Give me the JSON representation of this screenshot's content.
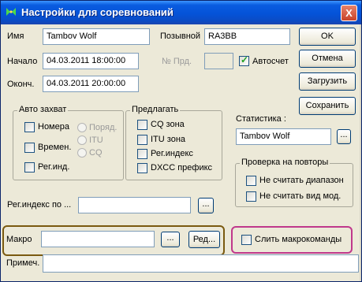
{
  "window": {
    "title": "Настройки для соревнований",
    "close_label": "X"
  },
  "fields": {
    "name": {
      "label": "Имя",
      "value": "Tambov Wolf"
    },
    "callsign": {
      "label": "Позывной",
      "value": "RA3BB"
    },
    "start": {
      "label": "Начало",
      "value": "04.03.2011 18:00:00"
    },
    "end": {
      "label": "Оконч.",
      "value": "04.03.2011 20:00:00"
    },
    "prd_no": {
      "label": "№ Прд.",
      "value": ""
    },
    "autocount": {
      "label": "Автосчет",
      "checked": true
    }
  },
  "buttons": {
    "ok": "OK",
    "cancel": "Отмена",
    "load": "Загрузить",
    "save": "Сохранить",
    "stats_browse": "...",
    "reg_browse": "...",
    "macro_browse": "...",
    "macro_edit": "Ред..."
  },
  "auto_capture": {
    "title": "Авто захват",
    "items": [
      {
        "label": "Номера",
        "checked": false
      },
      {
        "label": "Времен.",
        "checked": false
      },
      {
        "label": "Рег.инд.",
        "checked": false
      }
    ],
    "radios": [
      "Поряд.",
      "ITU",
      "CQ"
    ]
  },
  "suggest": {
    "title": "Предлагать",
    "items": [
      {
        "label": "CQ зона",
        "checked": false
      },
      {
        "label": "ITU зона",
        "checked": false
      },
      {
        "label": "Рег.индекс",
        "checked": false
      },
      {
        "label": "DXCC префикс",
        "checked": false
      }
    ]
  },
  "statistics": {
    "label": "Статистика :",
    "value": "Tambov Wolf"
  },
  "dup_check": {
    "title": "Проверка на повторы",
    "items": [
      {
        "label": "Не считать диапазон",
        "checked": false
      },
      {
        "label": "Не считать вид мод.",
        "checked": false
      }
    ]
  },
  "reg_index": {
    "label": "Рег.индекс по ...",
    "value": ""
  },
  "macro": {
    "label": "Макро",
    "value": "",
    "merge_label": "Слить макрокоманды",
    "merge_checked": false
  },
  "note": {
    "label": "Примеч.",
    "value": ""
  },
  "colors": {
    "macro_highlight": "#7a5a10",
    "merge_highlight": "#c0388c"
  }
}
